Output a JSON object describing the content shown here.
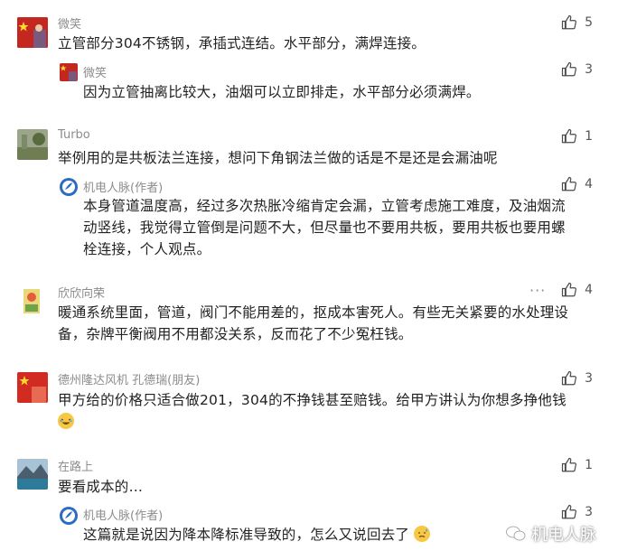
{
  "comments": [
    {
      "user": "微笑",
      "text": "立管部分304不锈钢，承插式连结。水平部分，满焊连接。",
      "likes": "5",
      "reply": {
        "user": "微笑",
        "text": "因为立管抽离比较大，油烟可以立即排走，水平部分必须满焊。",
        "likes": "3"
      }
    },
    {
      "user": "Turbo",
      "text": "举例用的是共板法兰连接，想问下角钢法兰做的话是不是还是会漏油呢",
      "likes": "1",
      "reply": {
        "user": "机电人脉(作者)",
        "text_lines": [
          "本身管道温度高，经过多次热胀冷缩肯定会漏，立管考虑施工难度，及油烟流",
          "动竖线，我觉得立管倒是问题不大，但尽量也不要用共板，要用共板也要用螺",
          "栓连接，个人观点。"
        ],
        "likes": "4"
      }
    },
    {
      "user": "欣欣向荣",
      "text_lines": [
        "暖通系统里面，管道，阀门不能用差的，抠成本害死人。有些无关紧要的水处理设",
        "备，杂牌平衡阀用不用都没关系，反而花了不少冤枉钱。"
      ],
      "likes": "4",
      "more": "···"
    },
    {
      "user": "德州隆达风机 孔德瑞(朋友)",
      "text": "甲方给的价格只适合做201，304的不挣钱甚至赔钱。给甲方讲认为你想多挣他钱",
      "likes": "3"
    },
    {
      "user": "在路上",
      "text": "要看成本的…",
      "likes": "1",
      "reply": {
        "user": "机电人脉(作者)",
        "text": "这篇就是说因为降本降标准导致的，怎么又说回去了",
        "likes": "3"
      }
    }
  ],
  "watermark": "机电人脉"
}
